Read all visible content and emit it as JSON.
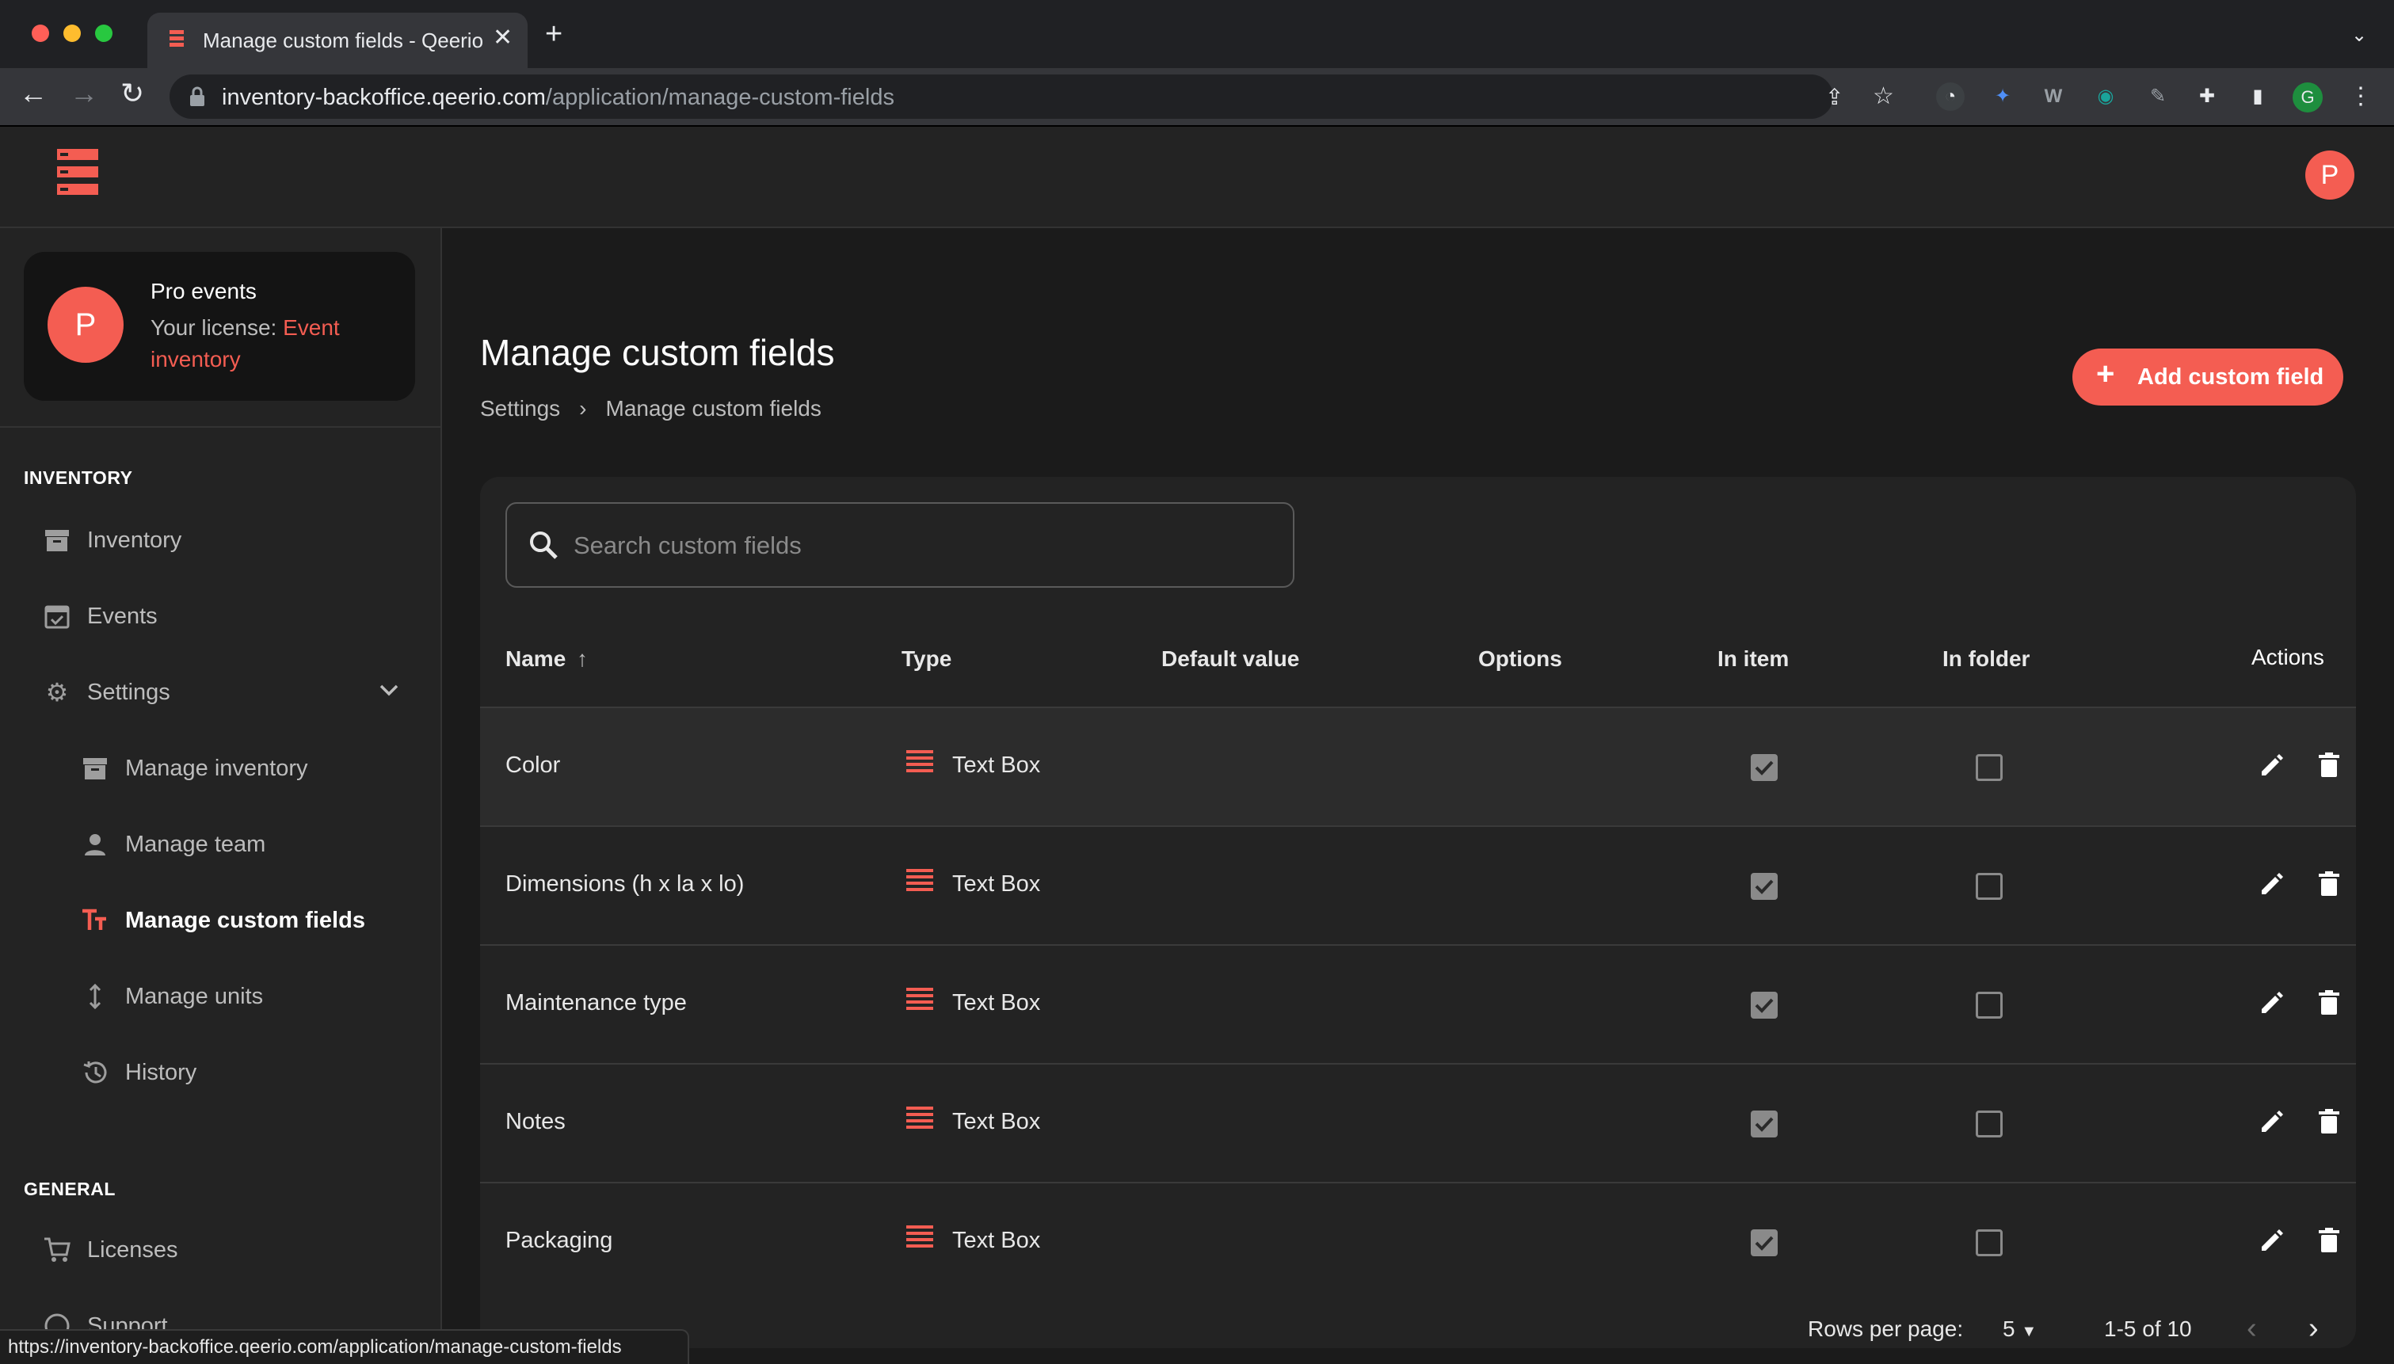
{
  "browser": {
    "tab_title": "Manage custom fields - Qeerio",
    "url_host": "inventory-backoffice.qeerio.com",
    "url_path": "/application/manage-custom-fields",
    "status_url": "https://inventory-backoffice.qeerio.com/application/manage-custom-fields",
    "profile_initial": "G"
  },
  "header": {
    "user_initial": "P"
  },
  "org": {
    "initial": "P",
    "name": "Pro events",
    "license_label": "Your license:",
    "license_value": "Event inventory"
  },
  "sidebar": {
    "section_inventory": "INVENTORY",
    "section_general": "GENERAL",
    "items": [
      {
        "label": "Inventory",
        "icon": "archive-icon"
      },
      {
        "label": "Events",
        "icon": "calendar-check-icon"
      },
      {
        "label": "Settings",
        "icon": "gear-icon"
      },
      {
        "label": "Manage inventory",
        "icon": "archive-icon"
      },
      {
        "label": "Manage team",
        "icon": "person-icon"
      },
      {
        "label": "Manage custom fields",
        "icon": "text-fields-icon"
      },
      {
        "label": "Manage units",
        "icon": "vertical-arrows-icon"
      },
      {
        "label": "History",
        "icon": "history-icon"
      },
      {
        "label": "Licenses",
        "icon": "cart-icon"
      },
      {
        "label": "Support",
        "icon": "help-icon"
      }
    ]
  },
  "page": {
    "title": "Manage custom fields",
    "breadcrumb": [
      "Settings",
      "Manage custom fields"
    ],
    "add_button": "Add custom field"
  },
  "search": {
    "placeholder": "Search custom fields"
  },
  "table": {
    "columns": [
      "Name",
      "Type",
      "Default value",
      "Options",
      "In item",
      "In folder",
      "Actions"
    ],
    "rows": [
      {
        "name": "Color",
        "type": "Text Box",
        "default_value": "",
        "options": "",
        "in_item": true,
        "in_folder": false
      },
      {
        "name": "Dimensions (h x la x lo)",
        "type": "Text Box",
        "default_value": "",
        "options": "",
        "in_item": true,
        "in_folder": false
      },
      {
        "name": "Maintenance type",
        "type": "Text Box",
        "default_value": "",
        "options": "",
        "in_item": true,
        "in_folder": false
      },
      {
        "name": "Notes",
        "type": "Text Box",
        "default_value": "",
        "options": "",
        "in_item": true,
        "in_folder": false
      },
      {
        "name": "Packaging",
        "type": "Text Box",
        "default_value": "",
        "options": "",
        "in_item": true,
        "in_folder": false
      }
    ]
  },
  "pagination": {
    "rows_per_page_label": "Rows per page:",
    "rows_per_page": "5",
    "range": "1-5 of 10"
  },
  "colors": {
    "accent": "#f45d52",
    "background": "#1b1b1b",
    "surface": "#232323"
  }
}
